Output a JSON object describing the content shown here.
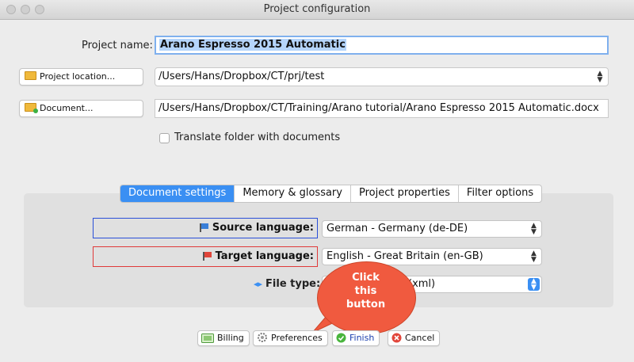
{
  "window": {
    "title": "Project configuration"
  },
  "form": {
    "project_name_label": "Project name:",
    "project_name_value": "Arano Espresso 2015 Automatic",
    "project_location_button": "Project location...",
    "project_location_value": "/Users/Hans/Dropbox/CT/prj/test",
    "document_button": "Document...",
    "document_value": "/Users/Hans/Dropbox/CT/Training/Arano tutorial/Arano Espresso 2015 Automatic.docx",
    "translate_folder_label": "Translate folder with documents"
  },
  "tabs": [
    {
      "label": "Document settings",
      "active": true
    },
    {
      "label": "Memory & glossary",
      "active": false
    },
    {
      "label": "Project properties",
      "active": false
    },
    {
      "label": "Filter options",
      "active": false
    }
  ],
  "settings": {
    "source_label": "Source language:",
    "source_value": "German - Germany (de-DE)",
    "target_label": "Target language:",
    "target_value": "English - Great Britain (en-GB)",
    "filetype_label": "File type:",
    "filetype_value": "(xml)"
  },
  "callout": {
    "line1": "Click",
    "line2": "this",
    "line3": "button"
  },
  "buttons": {
    "billing": "Billing",
    "preferences": "Preferences",
    "finish": "Finish",
    "cancel": "Cancel"
  },
  "colors": {
    "accent": "#3a8ff3",
    "source_box": "#2a4fd8",
    "target_box": "#e03a3a",
    "callout": "#f05a3f"
  }
}
